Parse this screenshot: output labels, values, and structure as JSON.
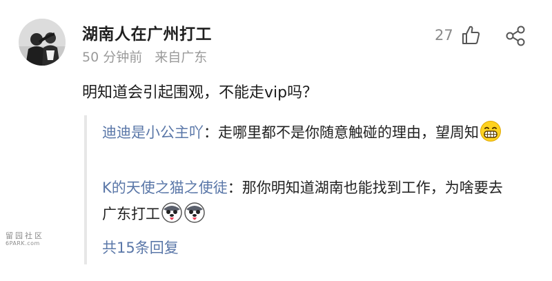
{
  "post": {
    "username": "湖南人在广州打工",
    "time": "50 分钟前",
    "location": "来自广东",
    "like_count": "27",
    "comment_text": "明知道会引起围观，不能走vip吗？"
  },
  "replies": [
    {
      "author": "迪迪是小公主吖",
      "separator": "：",
      "text": "走哪里都不是你随意触碰的理由，望周知",
      "emoji": "grin-emoji"
    },
    {
      "author": "K的天使之猫之使徒",
      "separator": "：",
      "text": "那你明知道湖南也能找到工作，为啥要去广东打工",
      "emoji": "husky-tongue-emoji-x2"
    }
  ],
  "more_replies": "共15条回复",
  "watermark": {
    "line1": "留园社区",
    "line2": "6PARK.com"
  },
  "colors": {
    "link": "#5a77a8",
    "meta": "#9a9a9a",
    "reply_border": "#e7e7e7"
  },
  "icons": [
    "thumb-up-icon",
    "share-icon"
  ]
}
